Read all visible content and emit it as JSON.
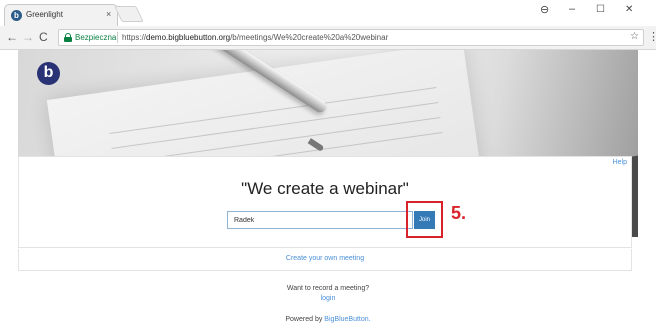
{
  "browser": {
    "tab_title": "Greenlight",
    "tab_close": "×",
    "secure_label": "Bezpieczna",
    "url_base": "https://",
    "url_host": "demo.bigbluebutton.org",
    "url_path": "/b/meetings/We%20create%20a%20webinar",
    "icons": [
      "back-icon",
      "forward-icon",
      "reload-icon",
      "lock-icon",
      "star-icon",
      "menu-icon",
      "account-icon"
    ]
  },
  "window": {
    "account": "⊖",
    "minimize": "–",
    "maximize": "☐",
    "close": "✕"
  },
  "hero": {
    "logo_letter": "b"
  },
  "card": {
    "help_label": "Help",
    "meeting_title": "\"We create a webinar\"",
    "name_value": "Radek",
    "join_label": "Join",
    "step_label": "5."
  },
  "create_link": "Create your own meeting",
  "footer": {
    "record_prompt": "Want to record a meeting?",
    "login_label": "login",
    "powered_by": "Powered by",
    "brand_link": "BigBlueButton."
  },
  "colors": {
    "accent": "#337ab7",
    "link": "#4a90d9",
    "annotation": "#d9232a",
    "secure": "#0b8043"
  }
}
